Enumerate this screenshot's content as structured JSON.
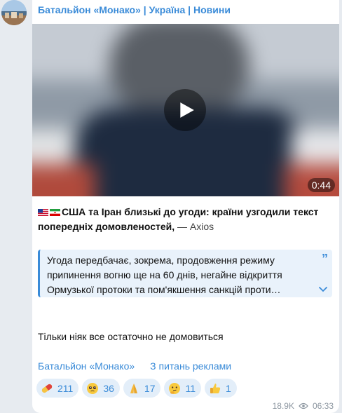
{
  "channel": {
    "name": "Батальйон «Монако» | Україна | Новини"
  },
  "video": {
    "duration": "0:44"
  },
  "post": {
    "headline": "США та Іран близькі до угоди: країни узгодили текст попередніх домовленостей,",
    "source": " — Axios",
    "flags": [
      "us-flag-icon",
      "iran-flag-icon"
    ],
    "quote": "Угода передбачає, зокрема, продовження режиму припинення вогню ще на 60 днів, негайне відкриття Ормузької протоки та пом'якшення санкцій проти…",
    "comment": "Тільки ніяк все остаточно не домовиться",
    "links": {
      "channel": "Батальйон «Монако»",
      "ads": "З питань реклами"
    }
  },
  "reactions": [
    {
      "icon": "pill-icon",
      "count": "211"
    },
    {
      "icon": "pleading-face-icon",
      "count": "36"
    },
    {
      "icon": "folded-hands-icon",
      "count": "17"
    },
    {
      "icon": "thinking-face-icon",
      "count": "11"
    },
    {
      "icon": "thumbs-up-icon",
      "count": "1"
    }
  ],
  "meta": {
    "views": "18.9K",
    "time": "06:33"
  },
  "colors": {
    "accent": "#3a8bd8",
    "background": "#e7ebf0",
    "quote_bg": "#e9f2fb"
  }
}
